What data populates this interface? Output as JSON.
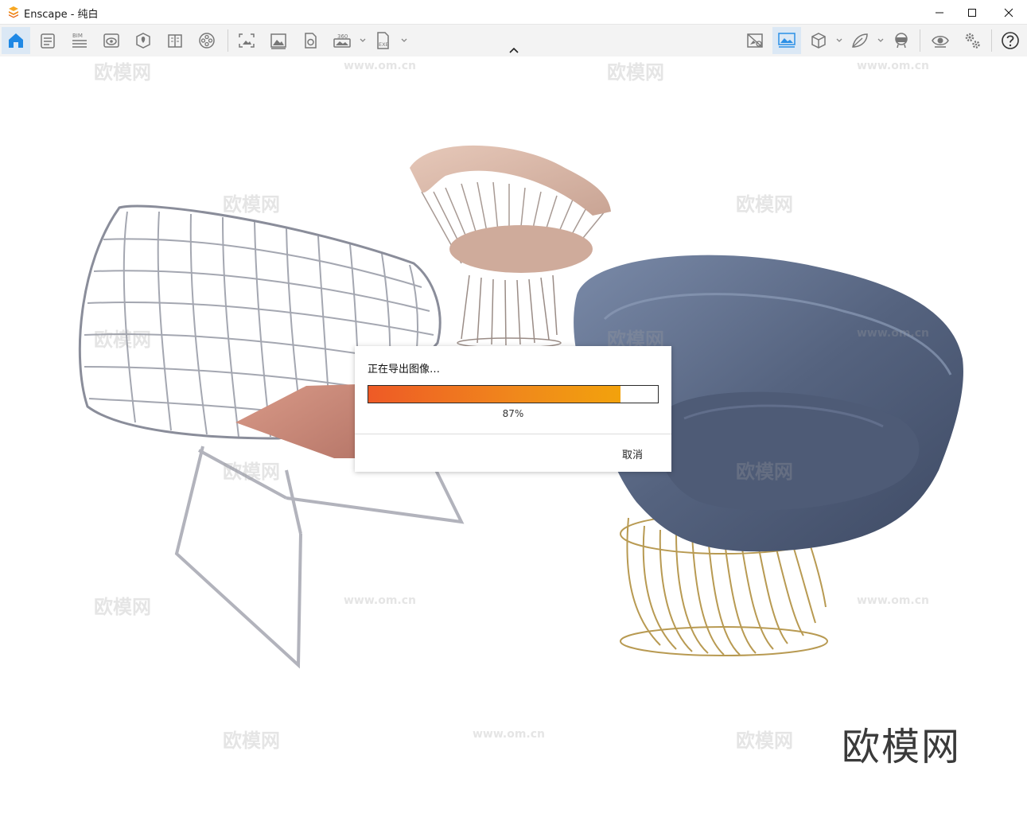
{
  "window": {
    "title": "Enscape - 纯白",
    "controls": [
      "minimize",
      "maximize",
      "close"
    ]
  },
  "toolbar": {
    "left_icons": [
      "home-icon",
      "views-icon",
      "bim-icon",
      "visual-settings-icon",
      "site-context-icon",
      "book-icon",
      "video-editor-icon",
      "screenshot-icon",
      "image-export-icon",
      "batch-render-icon",
      "panorama-360-icon",
      "exe-export-icon"
    ],
    "bim_label": "BIM",
    "pano_label": "360",
    "exe_label": "EXE",
    "right_icons": [
      "sync-off-icon",
      "sync-views-icon",
      "cube-icon",
      "asset-library-icon",
      "vr-headset-icon",
      "eye-icon",
      "settings-icon",
      "help-icon"
    ],
    "active": [
      "home-icon",
      "sync-views-icon"
    ]
  },
  "dialog": {
    "title": "正在导出图像…",
    "progress": 0.87,
    "percent_label": "87%",
    "cancel_label": "取消"
  },
  "watermark": {
    "brand": "欧模网",
    "url": "www.om.cn"
  },
  "colors": {
    "accent": "#1e88e5",
    "progress_start": "#ee5a26",
    "progress_end": "#f2a20c",
    "chair_blue": "#56647f",
    "chair_pink": "#d9b6a6",
    "gold": "#b89a52"
  }
}
